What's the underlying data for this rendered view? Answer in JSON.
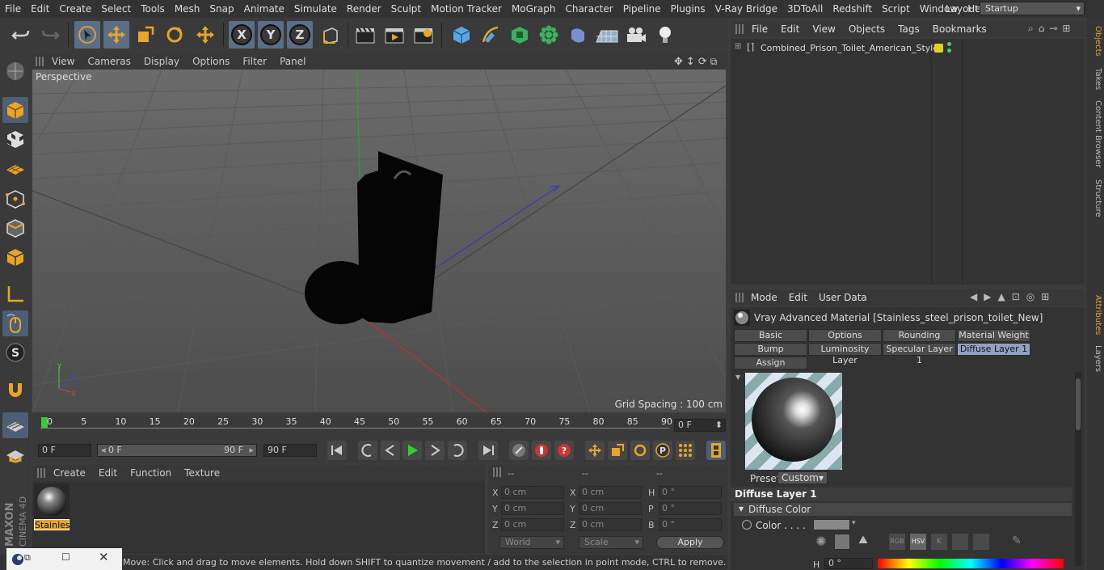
{
  "menu": [
    "File",
    "Edit",
    "Create",
    "Select",
    "Tools",
    "Mesh",
    "Snap",
    "Animate",
    "Simulate",
    "Render",
    "Sculpt",
    "Motion Tracker",
    "MoGraph",
    "Character",
    "Pipeline",
    "Plugins",
    "V-Ray Bridge",
    "3DToAll",
    "Redshift",
    "Script",
    "Window",
    "Help"
  ],
  "layout": {
    "label": "Layout:",
    "value": "Startup"
  },
  "viewport": {
    "menu": [
      "View",
      "Cameras",
      "Display",
      "Options",
      "Filter",
      "Panel"
    ],
    "camera": "Perspective",
    "grid_spacing": "Grid Spacing : 100 cm"
  },
  "timeline": {
    "ticks": [
      "0",
      "5",
      "10",
      "15",
      "20",
      "25",
      "30",
      "35",
      "40",
      "45",
      "50",
      "55",
      "60",
      "65",
      "70",
      "75",
      "80",
      "85",
      "90"
    ],
    "current_frame": "0 F",
    "start_frame": "0 F",
    "range_start": "0 F",
    "range_end": "90 F",
    "end_frame": "90 F"
  },
  "material_manager": {
    "menu": [
      "Create",
      "Edit",
      "Function",
      "Texture"
    ],
    "material_label": "Stainles"
  },
  "coordinates": {
    "headers": [
      "--",
      "--",
      "--"
    ],
    "rows": [
      {
        "l1": "X",
        "v1": "0 cm",
        "l2": "X",
        "v2": "0 cm",
        "l3": "H",
        "v3": "0 °"
      },
      {
        "l1": "Y",
        "v1": "0 cm",
        "l2": "Y",
        "v2": "0 cm",
        "l3": "P",
        "v3": "0 °"
      },
      {
        "l1": "Z",
        "v1": "0 cm",
        "l2": "Z",
        "v2": "0 cm",
        "l3": "B",
        "v3": "0 °"
      }
    ],
    "mode": "World",
    "scale": "Scale",
    "apply": "Apply"
  },
  "status": "Move: Click and drag to move elements. Hold down SHIFT to quantize movement / add to the selection in point mode, CTRL to remove.",
  "objects": {
    "menu": [
      "File",
      "Edit",
      "View",
      "Objects",
      "Tags",
      "Bookmarks"
    ],
    "items": [
      {
        "name": "Combined_Prison_Toilet_American_Style"
      }
    ]
  },
  "attributes": {
    "menu": [
      "Mode",
      "Edit",
      "User Data"
    ],
    "title": "Vray Advanced Material [Stainless_steel_prison_toilet_New]",
    "tabs_row1": [
      "Basic",
      "Options",
      "Rounding",
      "Material Weight"
    ],
    "tabs_row2": [
      "Bump",
      "Luminosity Layer",
      "Specular Layer 1",
      "Diffuse Layer 1"
    ],
    "tabs_row3": [
      "Assign"
    ],
    "preset_label": "Preset",
    "preset_value": "Custom",
    "section": "Diffuse Layer 1",
    "group": "Diffuse Color",
    "color_label": "Color . . . .",
    "h_label": "H",
    "h_value": "0 °",
    "color_modes": [
      "RGB",
      "HSV",
      "K"
    ]
  },
  "side_tabs": [
    "Objects",
    "Takes",
    "Content Browser",
    "Structure",
    "Attributes",
    "Layers"
  ],
  "colors": {
    "accent": "#e0a030",
    "selected_tab": "#8fa3c0",
    "active_tool": "#5a6f85"
  }
}
